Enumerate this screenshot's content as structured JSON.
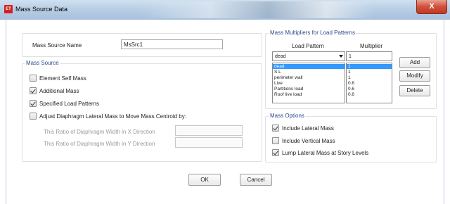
{
  "window": {
    "title": "Mass Source Data",
    "app_icon": "ET",
    "close_label": "X"
  },
  "mass_source_name": {
    "label": "Mass Source Name",
    "value": "MsSrc1"
  },
  "mass_source": {
    "title": "Mass Source",
    "element_self_mass": {
      "label": "Element Self Mass",
      "checked": false
    },
    "additional_mass": {
      "label": "Additional Mass",
      "checked": true
    },
    "specified_load_patterns": {
      "label": "Specified Load Patterns",
      "checked": true
    },
    "adjust_diaphragm": {
      "label": "Adjust Diaphragm Lateral Mass to Move Mass Centroid by:",
      "checked": false
    },
    "ratio_x": {
      "label": "This Ratio of Diaphragm Width in X Direction",
      "value": ""
    },
    "ratio_y": {
      "label": "This Ratio of Diaphragm Width in Y Direction",
      "value": ""
    }
  },
  "mass_multipliers": {
    "title": "Mass Multipliers for Load Patterns",
    "col_load_pattern": "Load Pattern",
    "col_multiplier": "Multiplier",
    "pattern_select_value": "dead",
    "multiplier_input_value": "1",
    "rows": [
      {
        "pattern": "dead",
        "multiplier": "1"
      },
      {
        "pattern": "S.L",
        "multiplier": "1"
      },
      {
        "pattern": "perimeter wall",
        "multiplier": "1"
      },
      {
        "pattern": "Live",
        "multiplier": "0.6"
      },
      {
        "pattern": "Partitions load",
        "multiplier": "0.6"
      },
      {
        "pattern": "Roof live load",
        "multiplier": "0.6"
      }
    ],
    "add_label": "Add",
    "modify_label": "Modify",
    "delete_label": "Delete"
  },
  "mass_options": {
    "title": "Mass Options",
    "include_lateral": {
      "label": "Include Lateral Mass",
      "checked": true
    },
    "include_vertical": {
      "label": "Include Vertical Mass",
      "checked": false
    },
    "lump_lateral": {
      "label": "Lump Lateral Mass at Story Levels",
      "checked": true
    }
  },
  "footer": {
    "ok_label": "OK",
    "cancel_label": "Cancel"
  }
}
